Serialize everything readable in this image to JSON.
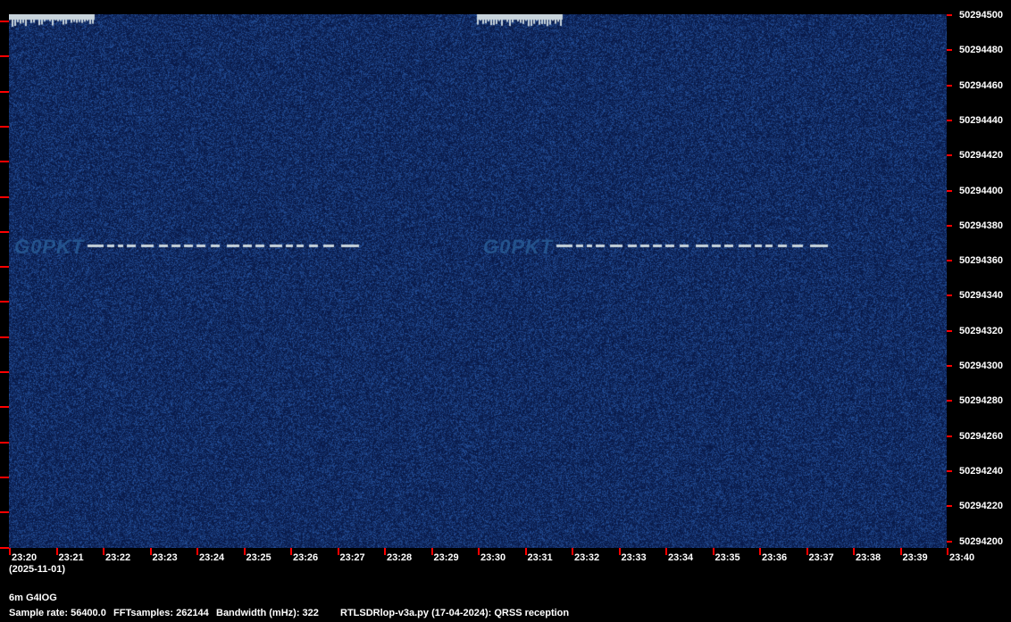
{
  "spectrogram": {
    "freq_labels": [
      "50294500",
      "50294480",
      "50294460",
      "50294440",
      "50294420",
      "50294400",
      "50294380",
      "50294360",
      "50294340",
      "50294320",
      "50294300",
      "50294280",
      "50294260",
      "50294240",
      "50294220",
      "50294200"
    ],
    "time_labels": [
      "23:20",
      "23:21",
      "23:22",
      "23:23",
      "23:24",
      "23:25",
      "23:26",
      "23:27",
      "23:28",
      "23:29",
      "23:30",
      "23:31",
      "23:32",
      "23:33",
      "23:34",
      "23:35",
      "23:36",
      "23:37",
      "23:38",
      "23:39",
      "23:40"
    ],
    "signal_callsign": "G0PKT",
    "colors": {
      "background": "#0b1c4e",
      "tick": "#ff0000",
      "signal": "#c8d4dc"
    }
  },
  "info": {
    "date": "(2025-11-01)",
    "station": "6m G4IOG",
    "sample_rate": "Sample rate: 56400.0",
    "fft_samples": "FFTsamples: 262144",
    "bandwidth": "Bandwidth (mHz): 322",
    "software": "RTLSDRlop-v3a.py (17-04-2024): QRSS reception"
  }
}
